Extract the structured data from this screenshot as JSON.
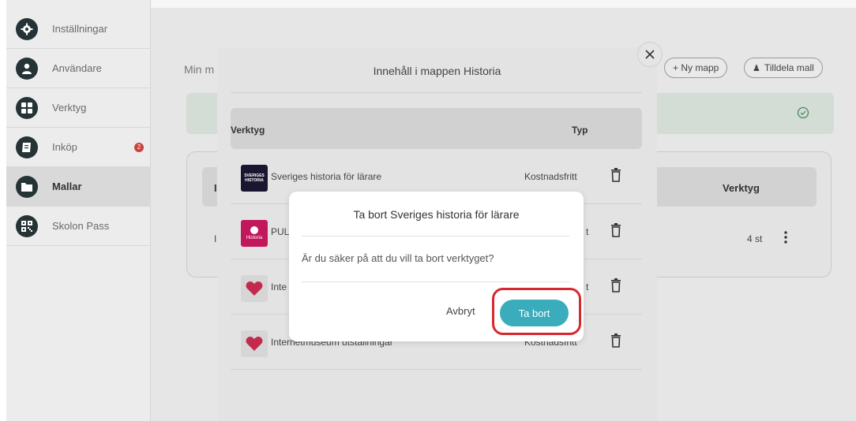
{
  "sidebar": {
    "items": [
      {
        "label": "Inställningar",
        "icon": "gear-icon"
      },
      {
        "label": "Användare",
        "icon": "user-icon"
      },
      {
        "label": "Verktyg",
        "icon": "grid-icon"
      },
      {
        "label": "Inköp",
        "icon": "book-icon",
        "badge": "2"
      },
      {
        "label": "Mallar",
        "icon": "folder-icon"
      },
      {
        "label": "Skolon Pass",
        "icon": "qr-icon"
      }
    ]
  },
  "main": {
    "title": "Min m",
    "new_folder_label": "+ Ny mapp",
    "assign_template_label": "Tilldela mall",
    "card_header_label": "Verktyg",
    "card_count": "4 st",
    "card_row_letter_1": "I",
    "card_row_letter_2": "I"
  },
  "folder_modal": {
    "title": "Innehåll i mappen Historia",
    "columns": {
      "tool": "Verktyg",
      "type": "Typ"
    },
    "rows": [
      {
        "name": "Sveriges historia för lärare",
        "type": "Kostnadsfritt",
        "thumb_text": "SVERIGES HISTORIA"
      },
      {
        "name": "PUL",
        "type": "t",
        "thumb_text": "Historia"
      },
      {
        "name": "Inte",
        "type": "t",
        "thumb_text": ""
      },
      {
        "name": "Internetmuseum utställningar",
        "type": "Kostnadsfritt",
        "thumb_text": ""
      }
    ]
  },
  "confirm_modal": {
    "title": "Ta bort Sveriges historia för lärare",
    "message": "Är du säker på att du vill ta bort verktyget?",
    "cancel_label": "Avbryt",
    "confirm_label": "Ta bort"
  },
  "colors": {
    "accent": "#3aacbc",
    "highlight": "#d8282f",
    "sidebar_icon": "#253236",
    "badge": "#c9423c"
  }
}
